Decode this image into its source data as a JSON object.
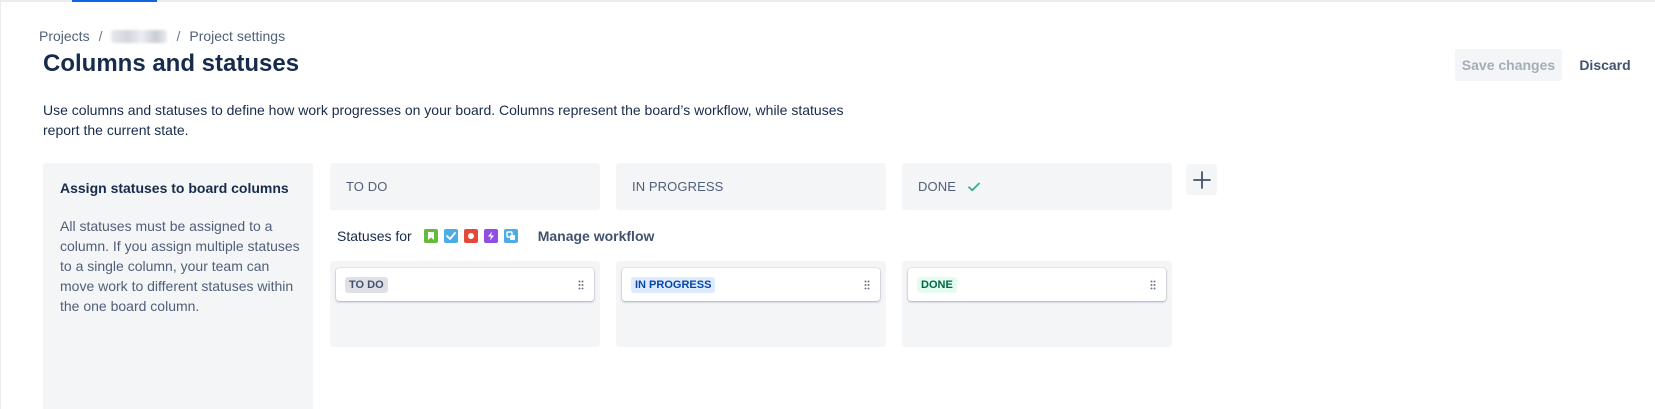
{
  "breadcrumb": {
    "projects": "Projects",
    "separator": "/",
    "current": "Project settings"
  },
  "page_title": "Columns and statuses",
  "actions": {
    "save_label": "Save changes",
    "discard_label": "Discard"
  },
  "description": "Use columns and statuses to define how work progresses on your board. Columns represent the board’s workflow, while statuses report the current state.",
  "info_panel": {
    "title": "Assign statuses to board columns",
    "text": "All statuses must be assigned to a column. If you assign multiple statuses to a single column, your team can move work to different statuses within the one board column."
  },
  "columns": [
    {
      "name": "TO DO",
      "status": "TO DO",
      "done_check": false
    },
    {
      "name": "IN PROGRESS",
      "status": "IN PROGRESS",
      "done_check": false
    },
    {
      "name": "DONE",
      "status": "DONE",
      "done_check": true
    }
  ],
  "statuses_for": {
    "label": "Statuses for",
    "issue_types": [
      {
        "icon": "story-icon",
        "color": "#63ba3c"
      },
      {
        "icon": "task-icon",
        "color": "#4bade8"
      },
      {
        "icon": "bug-icon",
        "color": "#e5493a"
      },
      {
        "icon": "epic-icon",
        "color": "#904ee2"
      },
      {
        "icon": "subtask-icon",
        "color": "#4bade8"
      }
    ],
    "manage_link": "Manage workflow"
  },
  "colors": {
    "accent": "#0c66e4",
    "done_green": "#36b37e"
  }
}
